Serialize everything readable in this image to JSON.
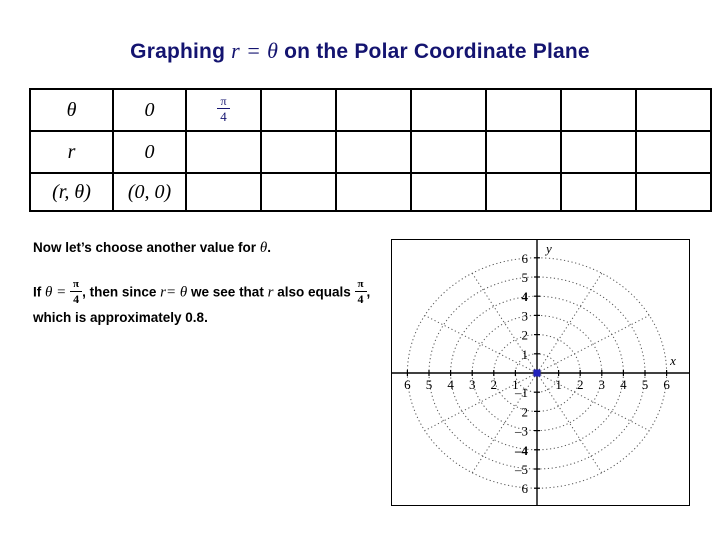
{
  "slide": {
    "title_prefix": "Graphing",
    "title_math_r": "r",
    "title_equals": "=",
    "title_math_theta": "θ",
    "title_suffix": "on the Polar Coordinate Plane",
    "title_color": "#141470"
  },
  "table": {
    "rows": [
      {
        "label": "θ",
        "cells": [
          "0",
          "π/4",
          "",
          "",
          "",
          "",
          "",
          ""
        ]
      },
      {
        "label": "r",
        "cells": [
          "0",
          "",
          "",
          "",
          "",
          "",
          "",
          ""
        ]
      },
      {
        "label": "(r, θ)",
        "cells": [
          "(0, 0)",
          "",
          "",
          "",
          "",
          "",
          "",
          ""
        ]
      }
    ],
    "theta_label": "θ",
    "r_label": "r",
    "pair_label_open": "(",
    "pair_label_r": "r",
    "pair_label_comma": ",",
    "pair_label_theta": "θ",
    "pair_label_close": ")",
    "zero_theta": "0",
    "zero_r": "0",
    "zero_pair": "(0, 0)",
    "fraction_pi": "π",
    "fraction_four": "4",
    "fraction_color": "#141470",
    "columns": 9
  },
  "body": {
    "line1_text": "Now let’s choose another value for",
    "line1_math": "θ",
    "line1_period": ".",
    "line2_if": "If",
    "line2_theta": "θ",
    "line2_equals": "=",
    "line2_frac_num": "π",
    "line2_frac_den": "4",
    "line2_comma": ",",
    "line2_then_since": "then since",
    "line2_r": "r",
    "line2_eq2": "=",
    "line2_theta2": "θ",
    "line2_we_see": "we see that",
    "line2_r2": "r",
    "line3_also_equals": "also equals",
    "line3_frac_num": "π",
    "line3_frac_den": "4",
    "line3_comma": ",",
    "line3_which_is": "which is approximately 0.8."
  },
  "chart_data": {
    "type": "scatter",
    "title": "",
    "subtitle": "polar coordinate grid",
    "grid": "polar",
    "xlabel": "x",
    "ylabel": "y",
    "xlim": [
      -6.6,
      6.6
    ],
    "ylim": [
      -6.6,
      6.6
    ],
    "x_ticks_negative": [
      "6",
      "5",
      "4",
      "3",
      "2",
      "1"
    ],
    "x_ticks_positive": [
      "1",
      "2",
      "3",
      "4",
      "5",
      "6"
    ],
    "y_ticks_positive": [
      "6",
      "5",
      "4",
      "3",
      "2",
      "1"
    ],
    "y_ticks_negative": [
      "–1",
      "2",
      "–3",
      "–4",
      "–5",
      "6"
    ],
    "polar_circle_radii": [
      1,
      2,
      3,
      4,
      5,
      6
    ],
    "polar_spoke_count": 12,
    "polar_spoke_step_degrees": 30,
    "grid_line_style": "dotted",
    "grid_color": "#555555",
    "axis_color": "#000000",
    "points": [
      {
        "label": "origin",
        "r": 0,
        "theta": 0,
        "x": 0,
        "y": 0,
        "color": "#2222bb",
        "marker": "square"
      }
    ]
  }
}
